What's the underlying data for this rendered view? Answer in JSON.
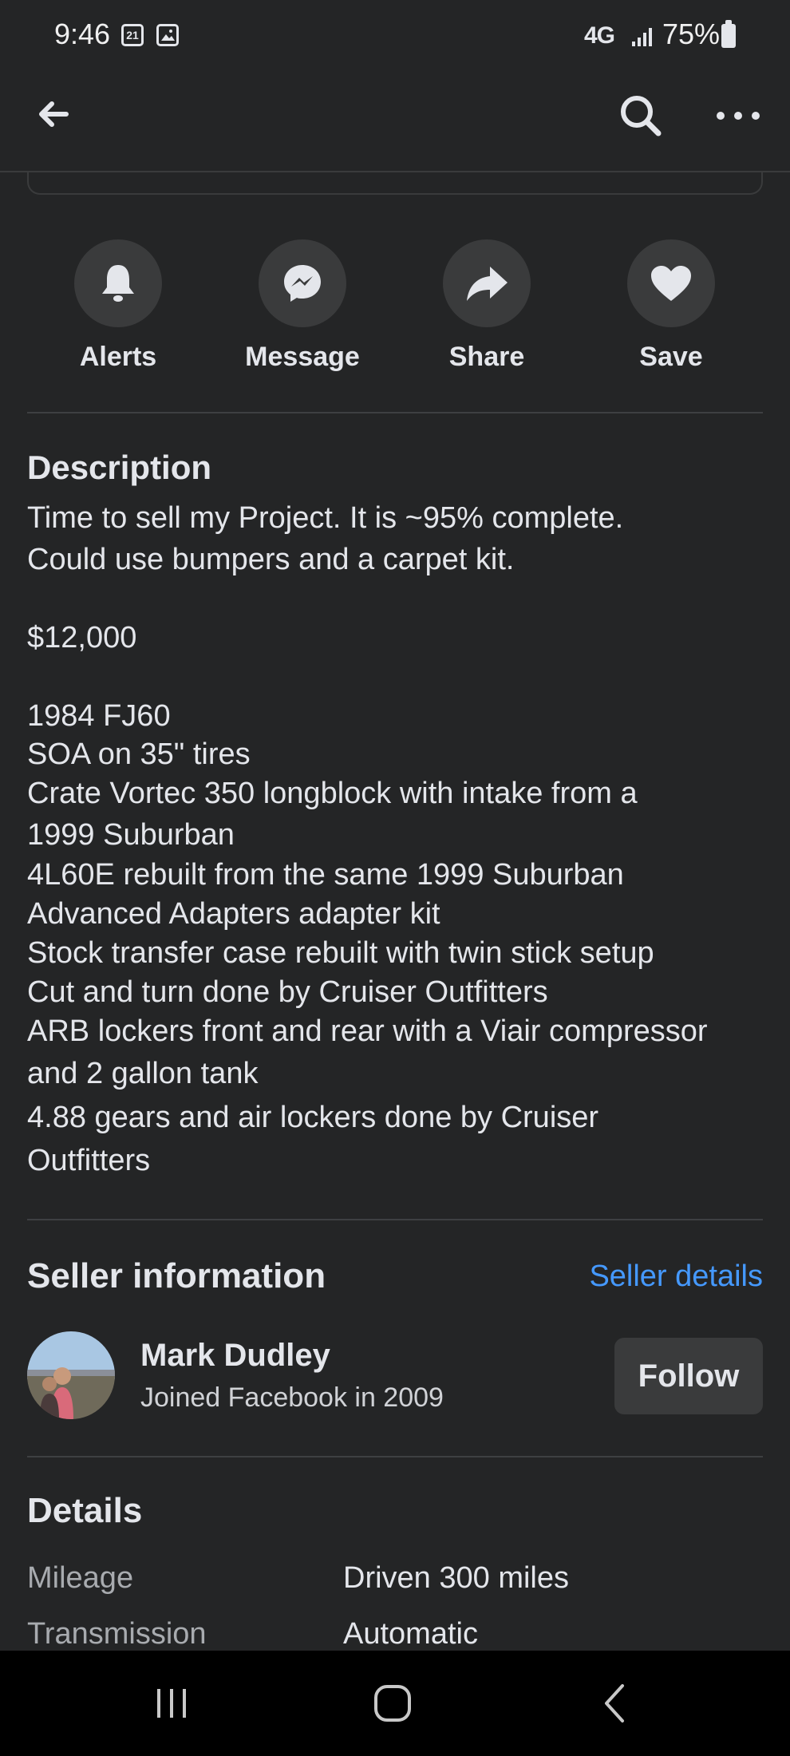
{
  "status": {
    "time": "9:46",
    "calendar_day": "21",
    "network": "4G",
    "battery": "75%"
  },
  "appbar": {
    "back_icon": "arrow-left-icon",
    "search_icon": "search-icon",
    "more_icon": "more-icon"
  },
  "actions": [
    {
      "label": "Alerts",
      "icon": "bell-icon"
    },
    {
      "label": "Message",
      "icon": "messenger-icon"
    },
    {
      "label": "Share",
      "icon": "share-icon"
    },
    {
      "label": "Save",
      "icon": "heart-icon"
    }
  ],
  "description": {
    "title": "Description",
    "lines": [
      "Time to sell my Project. It is ~95% complete.",
      "Could use bumpers and a carpet kit.",
      "$12,000",
      "1984 FJ60",
      "SOA on 35\" tires",
      "Crate Vortec 350 longblock with intake from a",
      "1999 Suburban",
      "4L60E rebuilt from the same 1999 Suburban",
      "Advanced Adapters adapter kit",
      "Stock transfer case rebuilt with twin stick setup",
      "Cut and turn done by Cruiser Outfitters",
      "ARB lockers front and rear with a Viair compressor",
      "and 2 gallon tank",
      "4.88 gears and air lockers done by Cruiser",
      "Outfitters"
    ]
  },
  "seller": {
    "title": "Seller information",
    "details_link": "Seller details",
    "name": "Mark Dudley",
    "joined": "Joined Facebook in 2009",
    "follow_label": "Follow"
  },
  "details": {
    "title": "Details",
    "rows": [
      {
        "label": "Mileage",
        "value": "Driven 300 miles"
      },
      {
        "label": "Transmission",
        "value": "Automatic"
      }
    ]
  },
  "colors": {
    "background": "#242526",
    "accent": "#4599ff",
    "surface": "#3a3b3c"
  }
}
